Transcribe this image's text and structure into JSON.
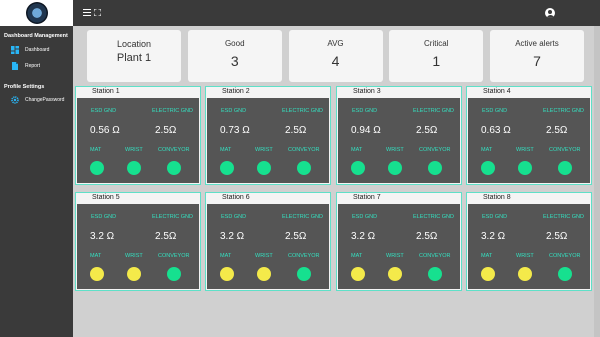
{
  "sidebar": {
    "section1": "Dashboard Management",
    "items": [
      {
        "label": "Dashboard",
        "icon": "dashboard-icon"
      },
      {
        "label": "Report",
        "icon": "report-icon"
      }
    ],
    "section2": "Profile Settings",
    "profile_items": [
      {
        "label": "ChangePassword",
        "icon": "gear-icon"
      }
    ]
  },
  "stats": [
    {
      "label": "Location",
      "value": "Plant 1"
    },
    {
      "label": "Good",
      "value": "3"
    },
    {
      "label": "AVG",
      "value": "4"
    },
    {
      "label": "Critical",
      "value": "1"
    },
    {
      "label": "Active alerts",
      "value": "7"
    }
  ],
  "labels": {
    "esd": "ESD GND",
    "electric": "ELECTRIC GND",
    "mat": "MAT",
    "wrist": "WRIST",
    "conveyor": "CONVEYOR"
  },
  "colors": {
    "green": "#16e08f",
    "yellow": "#f4ea4a",
    "teal": "#34e0c0"
  },
  "stations": [
    {
      "name": "Station 1",
      "esd": "0.56 Ω",
      "electric": "2.5Ω",
      "mat": "green",
      "wrist": "green",
      "conveyor": "green"
    },
    {
      "name": "Station 2",
      "esd": "0.73 Ω",
      "electric": "2.5Ω",
      "mat": "green",
      "wrist": "green",
      "conveyor": "green"
    },
    {
      "name": "Station 3",
      "esd": "0.94 Ω",
      "electric": "2.5Ω",
      "mat": "green",
      "wrist": "green",
      "conveyor": "green"
    },
    {
      "name": "Station 4",
      "esd": "0.63 Ω",
      "electric": "2.5Ω",
      "mat": "green",
      "wrist": "green",
      "conveyor": "green"
    },
    {
      "name": "Station 5",
      "esd": "3.2 Ω",
      "electric": "2.5Ω",
      "mat": "yellow",
      "wrist": "yellow",
      "conveyor": "green"
    },
    {
      "name": "Station 6",
      "esd": "3.2 Ω",
      "electric": "2.5Ω",
      "mat": "yellow",
      "wrist": "yellow",
      "conveyor": "green"
    },
    {
      "name": "Station 7",
      "esd": "3.2 Ω",
      "electric": "2.5Ω",
      "mat": "yellow",
      "wrist": "yellow",
      "conveyor": "green"
    },
    {
      "name": "Station 8",
      "esd": "3.2 Ω",
      "electric": "2.5Ω",
      "mat": "yellow",
      "wrist": "yellow",
      "conveyor": "green"
    }
  ]
}
